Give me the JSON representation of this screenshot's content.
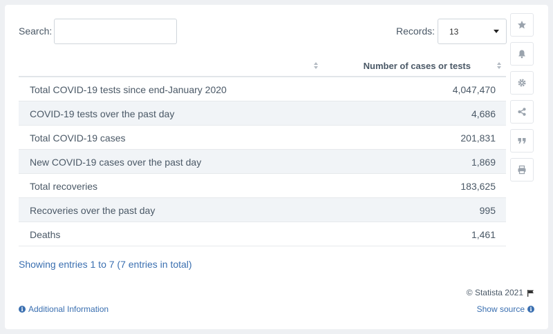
{
  "search": {
    "label": "Search:",
    "value": ""
  },
  "records": {
    "label": "Records:",
    "selected": "13"
  },
  "table": {
    "header_label": "",
    "header_value": "Number of cases or tests",
    "rows": [
      {
        "label": "Total COVID-19 tests since end-January 2020",
        "value": "4,047,470"
      },
      {
        "label": "COVID-19 tests over the past day",
        "value": "4,686"
      },
      {
        "label": "Total COVID-19 cases",
        "value": "201,831"
      },
      {
        "label": "New COVID-19 cases over the past day",
        "value": "1,869"
      },
      {
        "label": "Total recoveries",
        "value": "183,625"
      },
      {
        "label": "Recoveries over the past day",
        "value": "995"
      },
      {
        "label": "Deaths",
        "value": "1,461"
      }
    ]
  },
  "footer": {
    "showing": "Showing entries 1 to 7 (7 entries in total)",
    "copyright": "© Statista 2021",
    "additional_info": "Additional Information",
    "show_source": "Show source"
  },
  "sidebar_icons": [
    "star-icon",
    "bell-icon",
    "gear-icon",
    "share-icon",
    "quote-icon",
    "print-icon"
  ],
  "colors": {
    "link": "#3a6fb0",
    "row_alt": "#f1f4f7",
    "icon": "#9aa3ad"
  }
}
